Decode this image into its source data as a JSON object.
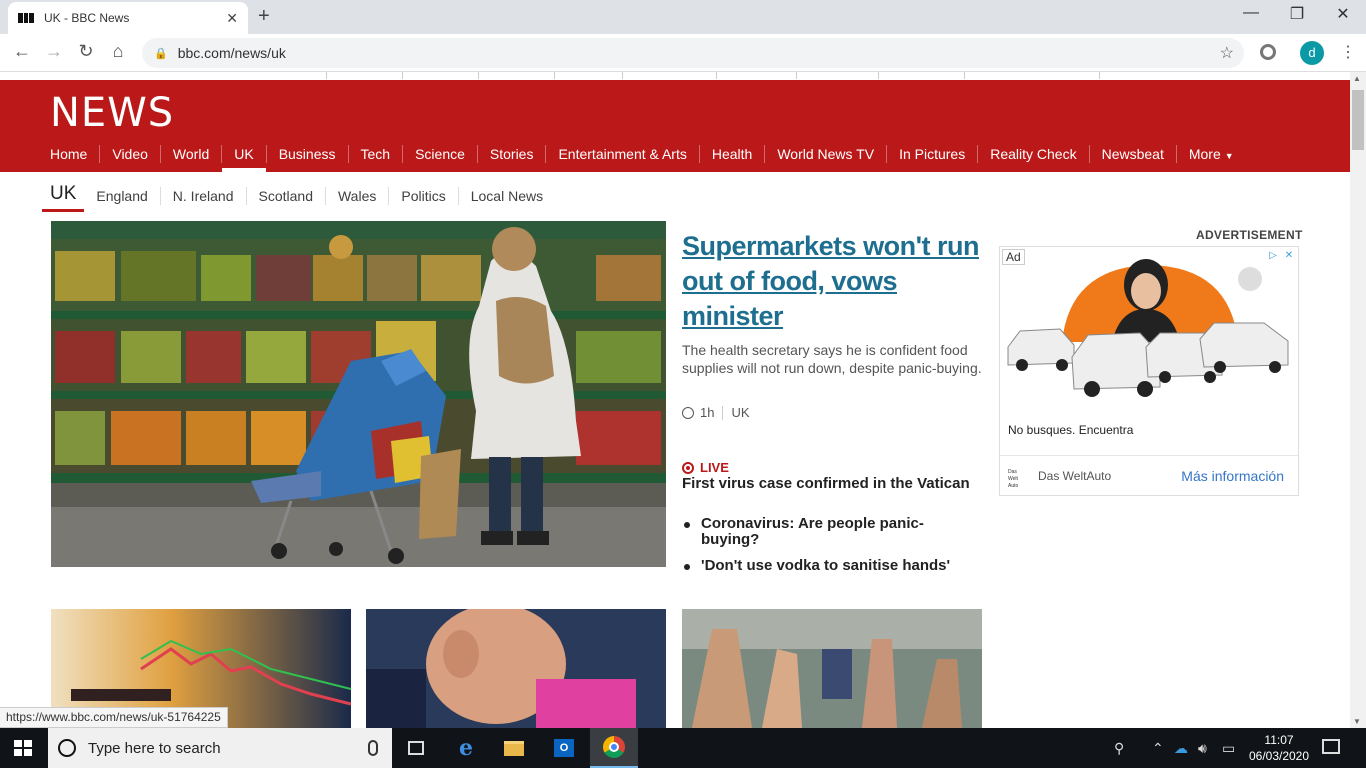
{
  "browser": {
    "tab_title": "UK - BBC News",
    "url": "bbc.com/news/uk",
    "profile_initial": "d",
    "status_url": "https://www.bbc.com/news/uk-51764225"
  },
  "header": {
    "logo": "NEWS",
    "nav": [
      "Home",
      "Video",
      "World",
      "UK",
      "Business",
      "Tech",
      "Science",
      "Stories",
      "Entertainment & Arts",
      "Health",
      "World News TV",
      "In Pictures",
      "Reality Check",
      "Newsbeat",
      "More"
    ],
    "active_nav": "UK"
  },
  "subnav": {
    "section": "UK",
    "items": [
      "England",
      "N. Ireland",
      "Scotland",
      "Wales",
      "Politics",
      "Local News"
    ]
  },
  "top_story": {
    "headline": "Supermarkets won't run out of food, vows minister",
    "summary": "The health secretary says he is confident food supplies will not run down, despite panic-buying.",
    "time": "1h",
    "tag": "UK"
  },
  "live": {
    "label": "LIVE",
    "title": "First virus case confirmed in the Vatican",
    "bullets": [
      "Coronavirus: Are people panic-buying?",
      "'Don't use vodka to sanitise hands'"
    ]
  },
  "ad": {
    "heading": "ADVERTISEMENT",
    "badge": "Ad",
    "text": "No busques. Encuentra",
    "brand": "Das WeltAuto",
    "brand_logo": "Das Welt Auto",
    "cta": "Más información"
  },
  "taskbar": {
    "search_placeholder": "Type here to search",
    "time": "11:07",
    "date": "06/03/2020",
    "outlook_letter": "O"
  },
  "colors": {
    "bbc_red": "#bb1919",
    "headline_link": "#1d6e8f",
    "taskbar": "#101317"
  }
}
